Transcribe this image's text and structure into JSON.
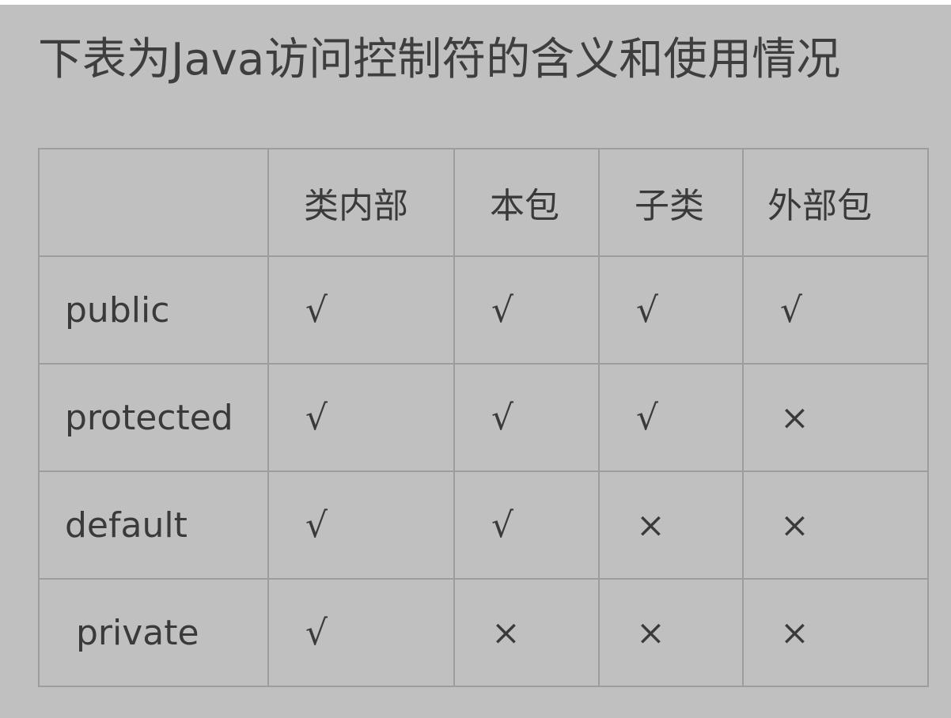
{
  "title": "下表为Java访问控制符的含义和使用情况",
  "table": {
    "headers": [
      "",
      "类内部",
      "本包",
      "子类",
      "外部包"
    ],
    "rows": [
      {
        "label": "public",
        "cells": [
          "√",
          "√",
          "√",
          "√"
        ]
      },
      {
        "label": "protected",
        "cells": [
          "√",
          "√",
          "√",
          "×"
        ]
      },
      {
        "label": "default",
        "cells": [
          "√",
          "√",
          "×",
          "×"
        ]
      },
      {
        "label": "private",
        "cells": [
          "√",
          "×",
          "×",
          "×"
        ]
      }
    ]
  }
}
